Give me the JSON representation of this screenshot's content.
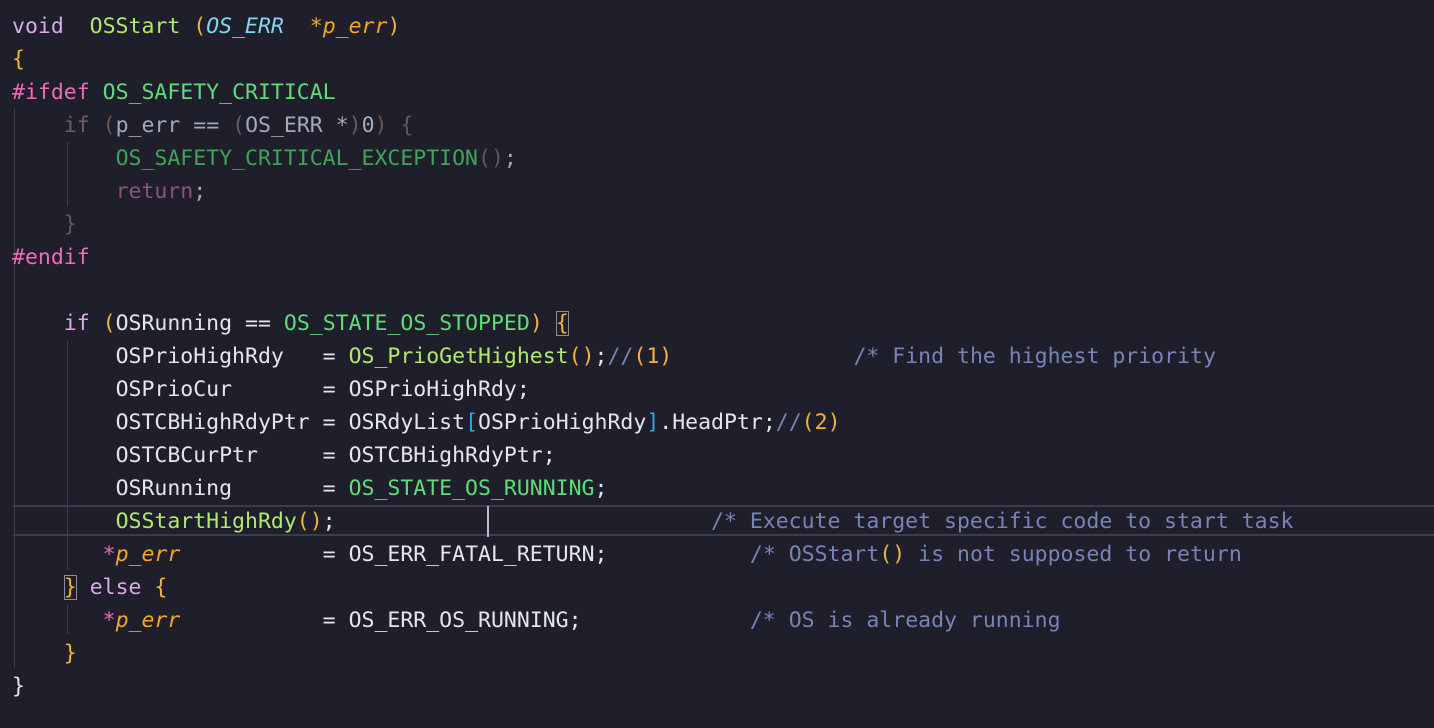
{
  "editor": {
    "language": "C",
    "cursor_line": 16,
    "lines": [
      "void  OSStart (OS_ERR  *p_err)",
      "{",
      "#ifdef OS_SAFETY_CRITICAL",
      "    if (p_err == (OS_ERR *)0) {",
      "        OS_SAFETY_CRITICAL_EXCEPTION();",
      "        return;",
      "    }",
      "#endif",
      "",
      "    if (OSRunning == OS_STATE_OS_STOPPED) {",
      "        OSPrioHighRdy   = OS_PrioGetHighest();//(1)              /* Find the highest priority",
      "        OSPrioCur       = OSPrioHighRdy;",
      "        OSTCBHighRdyPtr = OSRdyList[OSPrioHighRdy].HeadPtr;//(2)",
      "        OSTCBCurPtr     = OSTCBHighRdyPtr;",
      "        OSRunning       = OS_STATE_OS_RUNNING;",
      "        OSStartHighRdy();                             /* Execute target specific code to start task",
      "       *p_err           = OS_ERR_FATAL_RETURN;           /* OSStart() is not supposed to return",
      "    } else {",
      "       *p_err           = OS_ERR_OS_RUNNING;             /* OS is already running",
      "    }",
      "}"
    ]
  },
  "code": {
    "l1": {
      "kw": "void",
      "fn": "OSStart",
      "type": "OS_ERR",
      "param": "p_err"
    },
    "l3": {
      "pre": "#ifdef",
      "macro": "OS_SAFETY_CRITICAL"
    },
    "l4": {
      "kw": "if",
      "var": "p_err",
      "op": "==",
      "type": "OS_ERR",
      "zero": "0"
    },
    "l5": {
      "call": "OS_SAFETY_CRITICAL_EXCEPTION"
    },
    "l6": {
      "kw": "return"
    },
    "l8": {
      "pre": "#endif"
    },
    "l10": {
      "kw": "if",
      "var": "OSRunning",
      "op": "==",
      "macro": "OS_STATE_OS_STOPPED"
    },
    "l11": {
      "lhs": "OSPrioHighRdy",
      "call": "OS_PrioGetHighest",
      "mark": "1",
      "comment": "/* Find the highest priority"
    },
    "l12": {
      "lhs": "OSPrioCur",
      "rhs": "OSPrioHighRdy"
    },
    "l13": {
      "lhs": "OSTCBHighRdyPtr",
      "arr": "OSRdyList",
      "idx": "OSPrioHighRdy",
      "field": ".HeadPtr",
      "mark": "2"
    },
    "l14": {
      "lhs": "OSTCBCurPtr",
      "rhs": "OSTCBHighRdyPtr"
    },
    "l15": {
      "lhs": "OSRunning",
      "rhs": "OS_STATE_OS_RUNNING"
    },
    "l16": {
      "call": "OSStartHighRdy",
      "comment": "/* Execute target specific code to start task"
    },
    "l17": {
      "param": "p_err",
      "rhs": "OS_ERR_FATAL_RETURN",
      "c1": "/* OSStart",
      "c2": " is not supposed to return"
    },
    "l18": {
      "kw": "else"
    },
    "l19": {
      "param": "p_err",
      "rhs": "OS_ERR_OS_RUNNING",
      "comment": "/* OS is already running"
    }
  }
}
